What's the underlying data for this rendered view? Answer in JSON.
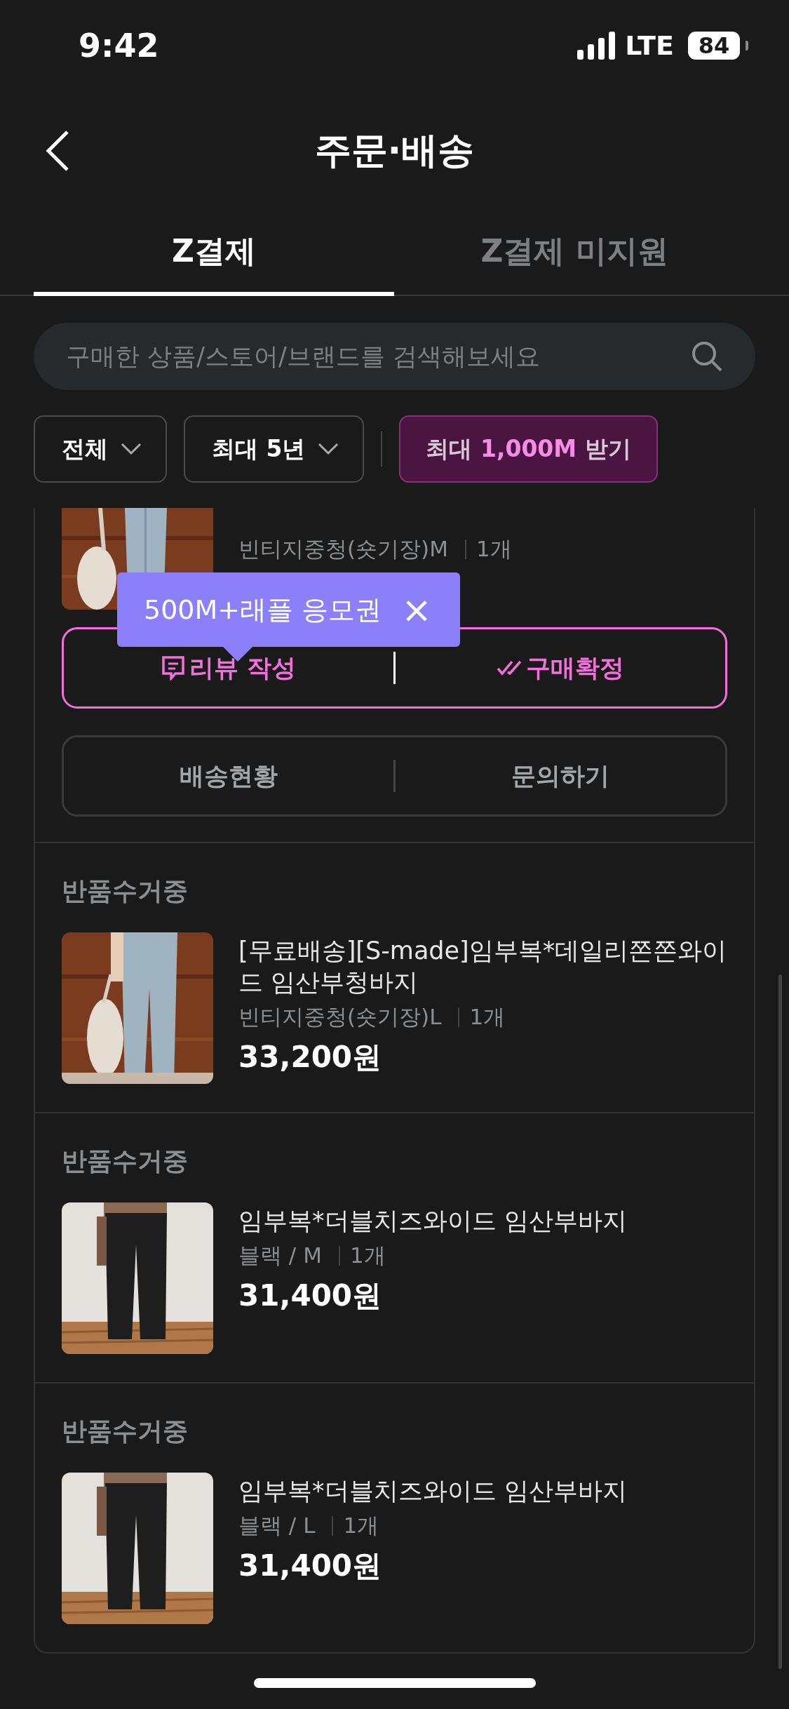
{
  "status_bar": {
    "time": "9:42",
    "network": "LTE",
    "battery": "84"
  },
  "header": {
    "title": "주문·배송"
  },
  "tabs": [
    {
      "label": "Z결제",
      "selected": true
    },
    {
      "label": "Z결제 미지원",
      "selected": false
    }
  ],
  "search": {
    "placeholder": "구매한 상품/스토어/브랜드를 검색해보세요"
  },
  "filters": [
    {
      "kind": "dropdown",
      "label": "전체"
    },
    {
      "kind": "dropdown",
      "label": "최대 5년"
    },
    {
      "kind": "promo",
      "prefix": "최대",
      "highlight": "1,000M",
      "suffix": "받기"
    }
  ],
  "first_order": {
    "option": "빈티지중청(숏기장)M",
    "quantity": "1개",
    "tooltip": "500M+래플 응모권",
    "close": "×",
    "actions": [
      {
        "kind": "review",
        "label": "리뷰 작성"
      },
      {
        "kind": "confirm",
        "label": "구매확정"
      }
    ],
    "secondary_actions": [
      "배송현황",
      "문의하기"
    ]
  },
  "orders": [
    {
      "status": "반품수거중",
      "title": "[무료배송][S-made]임부복*데일리쫀쫀와이드 임산부청바지",
      "option": "빈티지중청(숏기장)L",
      "quantity": "1개",
      "price": "33,200원"
    },
    {
      "status": "반품수거중",
      "title": "임부복*더블치즈와이드 임산부바지",
      "option": "블랙 / M",
      "quantity": "1개",
      "price": "31,400원"
    },
    {
      "status": "반품수거중",
      "title": "임부복*더블치즈와이드 임산부바지",
      "option": "블랙 / L",
      "quantity": "1개",
      "price": "31,400원"
    }
  ]
}
